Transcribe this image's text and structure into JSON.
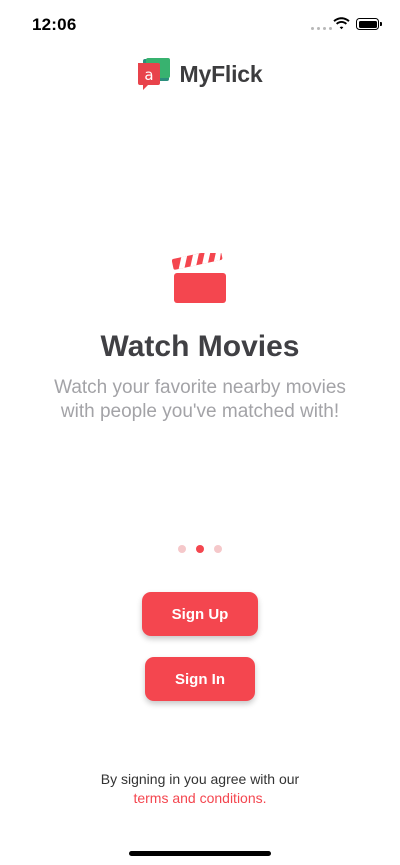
{
  "status_bar": {
    "time": "12:06",
    "icons": [
      "signal-dots-icon",
      "wifi-icon",
      "battery-icon"
    ]
  },
  "brand": {
    "logo_letter": "a",
    "name": "MyFlick",
    "logo_colors": {
      "red": "#e8434b",
      "green": "#38b26f",
      "teal": "#2a8e7c"
    }
  },
  "slide": {
    "icon": "clapperboard-icon",
    "title": "Watch Movies",
    "subtitle": "Watch your favorite nearby movies with people you've matched with!"
  },
  "pagination": {
    "total": 3,
    "active_index": 1
  },
  "buttons": {
    "sign_up": "Sign Up",
    "sign_in": "Sign In"
  },
  "legal": {
    "text": "By signing in you agree with our",
    "link": "terms and conditions."
  },
  "colors": {
    "accent": "#f4464f",
    "accent_light": "#f5c8ca",
    "title": "#404044",
    "subtitle": "#a3a3a7"
  }
}
